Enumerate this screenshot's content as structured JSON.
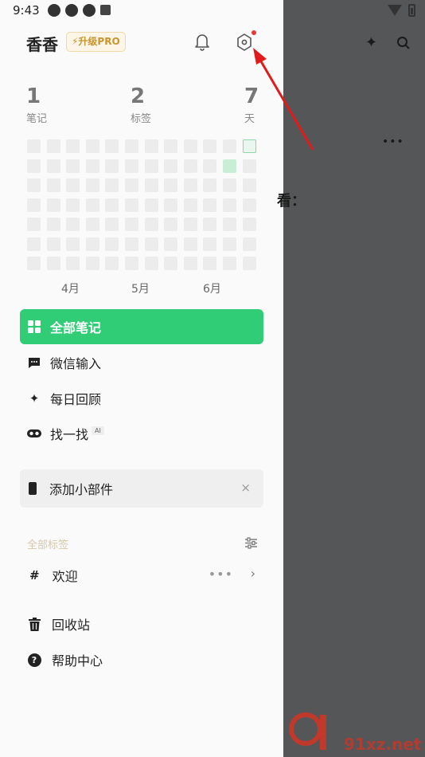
{
  "status_bar": {
    "time": "9:43"
  },
  "drawer": {
    "user_name": "香香",
    "pro_badge": "⚡升级PRO",
    "stats": [
      {
        "value": "1",
        "label": "笔记"
      },
      {
        "value": "2",
        "label": "标签"
      },
      {
        "value": "7",
        "label": "天"
      }
    ],
    "heatmap": {
      "months": [
        "4月",
        "5月",
        "6月"
      ]
    },
    "nav": [
      {
        "label": "全部笔记",
        "icon": "grid-icon",
        "active": true
      },
      {
        "label": "微信输入",
        "icon": "chat-icon",
        "active": false
      },
      {
        "label": "每日回顾",
        "icon": "sparkle-icon",
        "active": false
      },
      {
        "label": "找一找",
        "icon": "glasses-icon",
        "active": false,
        "tag": "AI"
      }
    ],
    "widget_banner": {
      "label": "添加小部件",
      "close": "×"
    },
    "tags_section": {
      "heading": "全部标签",
      "items": [
        {
          "label": "欢迎",
          "prefix": "#",
          "more": "•••",
          "chevron": "›"
        }
      ]
    },
    "bottom": [
      {
        "label": "回收站",
        "icon": "trash-icon"
      },
      {
        "label": "帮助中心",
        "icon": "help-icon",
        "glyph": "?"
      }
    ]
  },
  "background_view": {
    "more": "•••",
    "partial_text": "看："
  },
  "watermark": {
    "text": "91xz.net"
  },
  "colors": {
    "accent_green": "#31cd76",
    "badge_gold": "#c9952e",
    "annotation_red": "#e11b1b"
  }
}
